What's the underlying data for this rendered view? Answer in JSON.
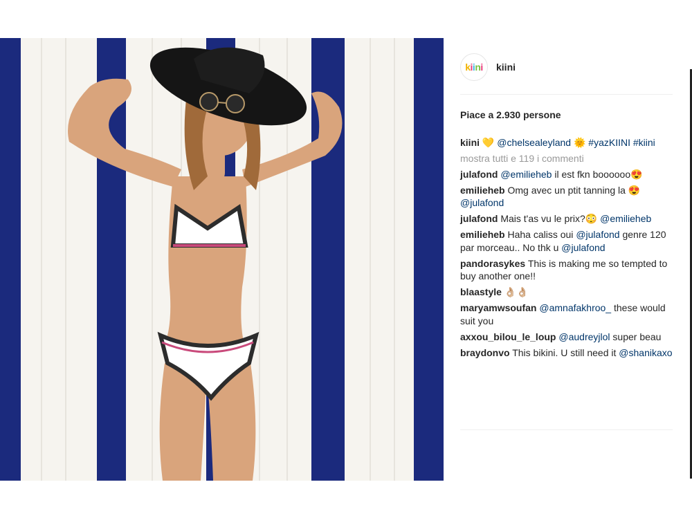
{
  "post": {
    "account": "kiini",
    "avatar_text": "kiini",
    "likes_text": "Piace a 2.930 persone",
    "caption": {
      "user": "kiini",
      "heart": "💛",
      "mention": "@chelsealeyland",
      "sun": "🌞",
      "tag1": "#yazKIINI",
      "tag2": "#kiini"
    },
    "more_comments": "mostra tutti e 119 i commenti"
  },
  "comments": [
    {
      "user": "julafond",
      "mention": "@emilieheb",
      "text": " il est fkn boooooo",
      "emoji": "😍"
    },
    {
      "user": "emilieheb",
      "text": "Omg avec un ptit tanning la ",
      "emoji": "😍",
      "mention2": "@julafond"
    },
    {
      "user": "julafond",
      "text": "Mais t'as vu le prix?",
      "emoji": "😳",
      "mention2": "@emilieheb"
    },
    {
      "user": "emilieheb",
      "text": "Haha caliss oui ",
      "mention": "@julafond",
      "text2": " genre 120 par morceau.. No thk u ",
      "mention2": "@julafond"
    },
    {
      "user": "pandorasykes",
      "text": "This is making me so tempted to buy another one!!"
    },
    {
      "user": "blaastyle",
      "emoji": "👌🏼👌🏼"
    },
    {
      "user": "maryamwsoufan",
      "mention": "@amnafakhroo_",
      "text": " these would suit you"
    },
    {
      "user": "axxou_bilou_le_loup",
      "mention": "@audreyjlol",
      "text": " super beau"
    },
    {
      "user": "braydonvo",
      "text": "This bikini. U still need it ",
      "mention2": "@shanikaxo"
    }
  ],
  "colors": {
    "stripe_blue": "#1b2a7d",
    "stripe_white": "#f6f4ef",
    "mention": "#003569",
    "muted": "#999999"
  }
}
